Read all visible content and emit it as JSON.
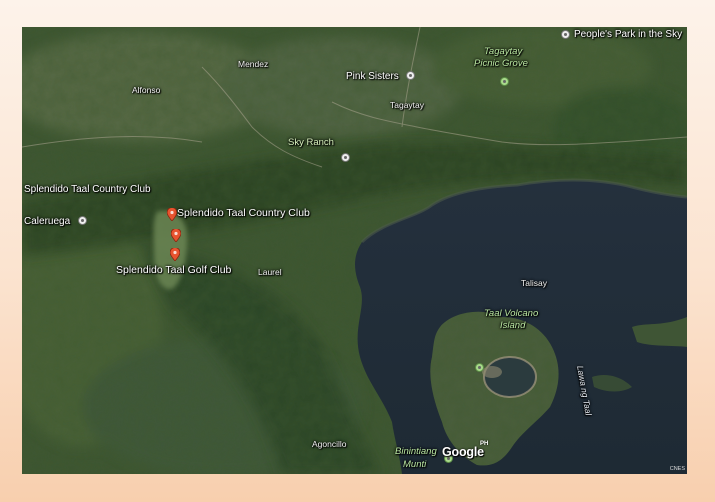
{
  "map": {
    "labels": {
      "peoples_park": "People's Park in the Sky",
      "mendez": "Mendez",
      "alfonso": "Alfonso",
      "pink_sisters": "Pink Sisters",
      "tagaytay_picnic_grove": "Tagaytay Picnic Grove",
      "tagaytay": "Tagaytay",
      "sky_ranch": "Sky Ranch",
      "splendido_country_club_left": "Splendido Taal Country Club",
      "splendido_country_club": "Splendido Taal Country Club",
      "caleruega": "Caleruega",
      "splendido_golf_club": "Splendido Taal Golf Club",
      "laurel": "Laurel",
      "talisay": "Talisay",
      "taal_volcano_island": "Taal Volcano Island",
      "lawa_ng_taal": "Lawa ng Taal",
      "agoncillo": "Agoncillo",
      "binintiang_munti": "Binintiang Munti",
      "google": "Google",
      "ph": "PH",
      "attribution": "CNES"
    }
  }
}
